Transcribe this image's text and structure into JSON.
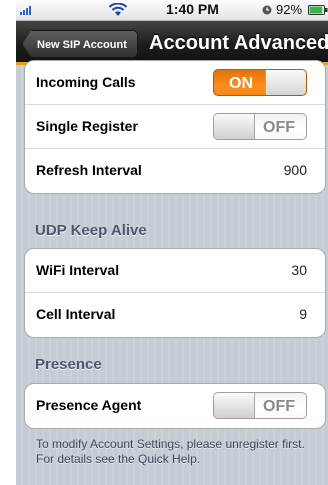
{
  "status_bar": {
    "time": "1:40 PM",
    "battery_percent": "92%",
    "battery_level": 0.92,
    "signal_bars": 4
  },
  "nav": {
    "back_label": "New SIP Account",
    "title": "Account Advanced"
  },
  "group_top": {
    "rows": [
      {
        "label": "Incoming Calls",
        "toggle": "ON",
        "state": "on"
      },
      {
        "label": "Single Register",
        "toggle": "OFF",
        "state": "off"
      },
      {
        "label": "Refresh Interval",
        "value": "900"
      }
    ]
  },
  "udp_section": {
    "header": "UDP Keep Alive",
    "rows": [
      {
        "label": "WiFi Interval",
        "value": "30"
      },
      {
        "label": "Cell Interval",
        "value": "9"
      }
    ]
  },
  "presence_section": {
    "header": "Presence",
    "rows": [
      {
        "label": "Presence Agent",
        "toggle": "OFF",
        "state": "off"
      }
    ]
  },
  "footer_note": "To modify Account Settings, please unregister first.  For details see the Quick Help.",
  "colors": {
    "accent_orange": "#ff8c1a",
    "nav_underline": "#e6a30c",
    "section_header": "#4c566c"
  },
  "icons": [
    "signal-icon",
    "wifi-icon",
    "alarm-icon",
    "battery-icon",
    "back-chevron-icon"
  ]
}
